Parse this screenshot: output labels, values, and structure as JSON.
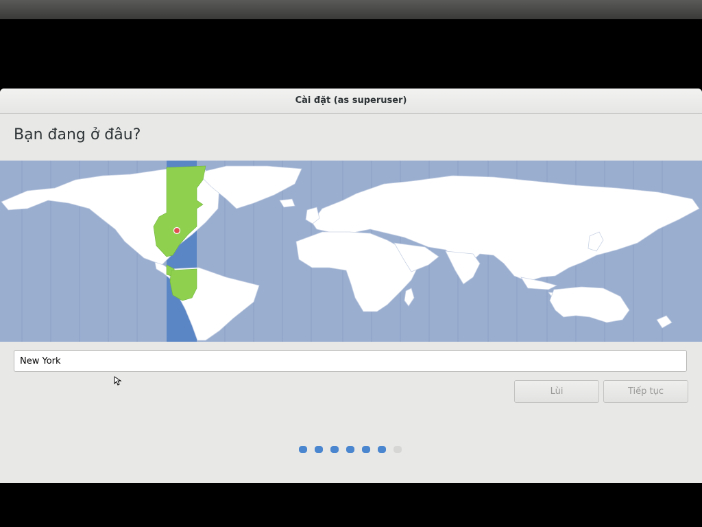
{
  "window": {
    "title": "Cài đặt (as superuser)"
  },
  "page": {
    "heading": "Bạn đang ở đâu?"
  },
  "map": {
    "ocean_color": "#9aaed0",
    "land_color": "#ffffff",
    "highlight_color": "#8fd14f",
    "selected_zone_color": "#5b86c5",
    "marker_color": "#e05050"
  },
  "location": {
    "value": "New York"
  },
  "buttons": {
    "back": "Lùi",
    "continue": "Tiếp tục"
  },
  "progress": {
    "total_steps": 7,
    "completed_steps": 6,
    "color": "#4a86cf"
  }
}
